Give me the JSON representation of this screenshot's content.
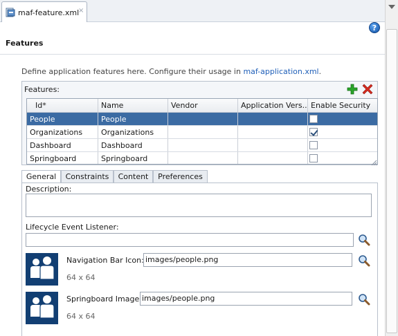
{
  "editor_tab": {
    "label": "maf-feature.xml",
    "close": "×"
  },
  "help": {
    "label": "?"
  },
  "page": {
    "title": "Features",
    "intro_text": "Define application features here. Configure their usage in ",
    "intro_link": "maf-application.xml",
    "intro_suffix": "."
  },
  "features_table": {
    "label": "Features:",
    "columns": [
      "Id*",
      "Name",
      "Vendor",
      "Application Vers...",
      "Enable Security"
    ],
    "rows": [
      {
        "id": "People",
        "name": "People",
        "vendor": "",
        "app_version": "",
        "enable_security": false,
        "selected": true
      },
      {
        "id": "Organizations",
        "name": "Organizations",
        "vendor": "",
        "app_version": "",
        "enable_security": true,
        "selected": false
      },
      {
        "id": "Dashboard",
        "name": "Dashboard",
        "vendor": "",
        "app_version": "",
        "enable_security": false,
        "selected": false
      },
      {
        "id": "Springboard",
        "name": "Springboard",
        "vendor": "",
        "app_version": "",
        "enable_security": false,
        "selected": false
      }
    ]
  },
  "subtabs": [
    "General",
    "Constraints",
    "Content",
    "Preferences"
  ],
  "active_subtab": "General",
  "general": {
    "description_label": "Description:",
    "description_value": "",
    "lifecycle_label": "Lifecycle Event Listener:",
    "lifecycle_value": "",
    "nav_icon_label": "Navigation Bar Icon:",
    "nav_icon_value": "images/people.png",
    "nav_icon_size": "64 x 64",
    "springboard_label": "Springboard Image:",
    "springboard_value": "images/people.png",
    "springboard_size": "64 x 64"
  },
  "colors": {
    "selected_row": "#3b6ba3",
    "link": "#1f5fb8",
    "thumbnail_bg": "#123f73",
    "add_icon": "#2aa52a",
    "delete_icon": "#d62b1f"
  },
  "icons": [
    "file-xml-icon",
    "close-icon",
    "help-icon",
    "add-icon",
    "delete-icon",
    "search-icon",
    "people-icon"
  ]
}
